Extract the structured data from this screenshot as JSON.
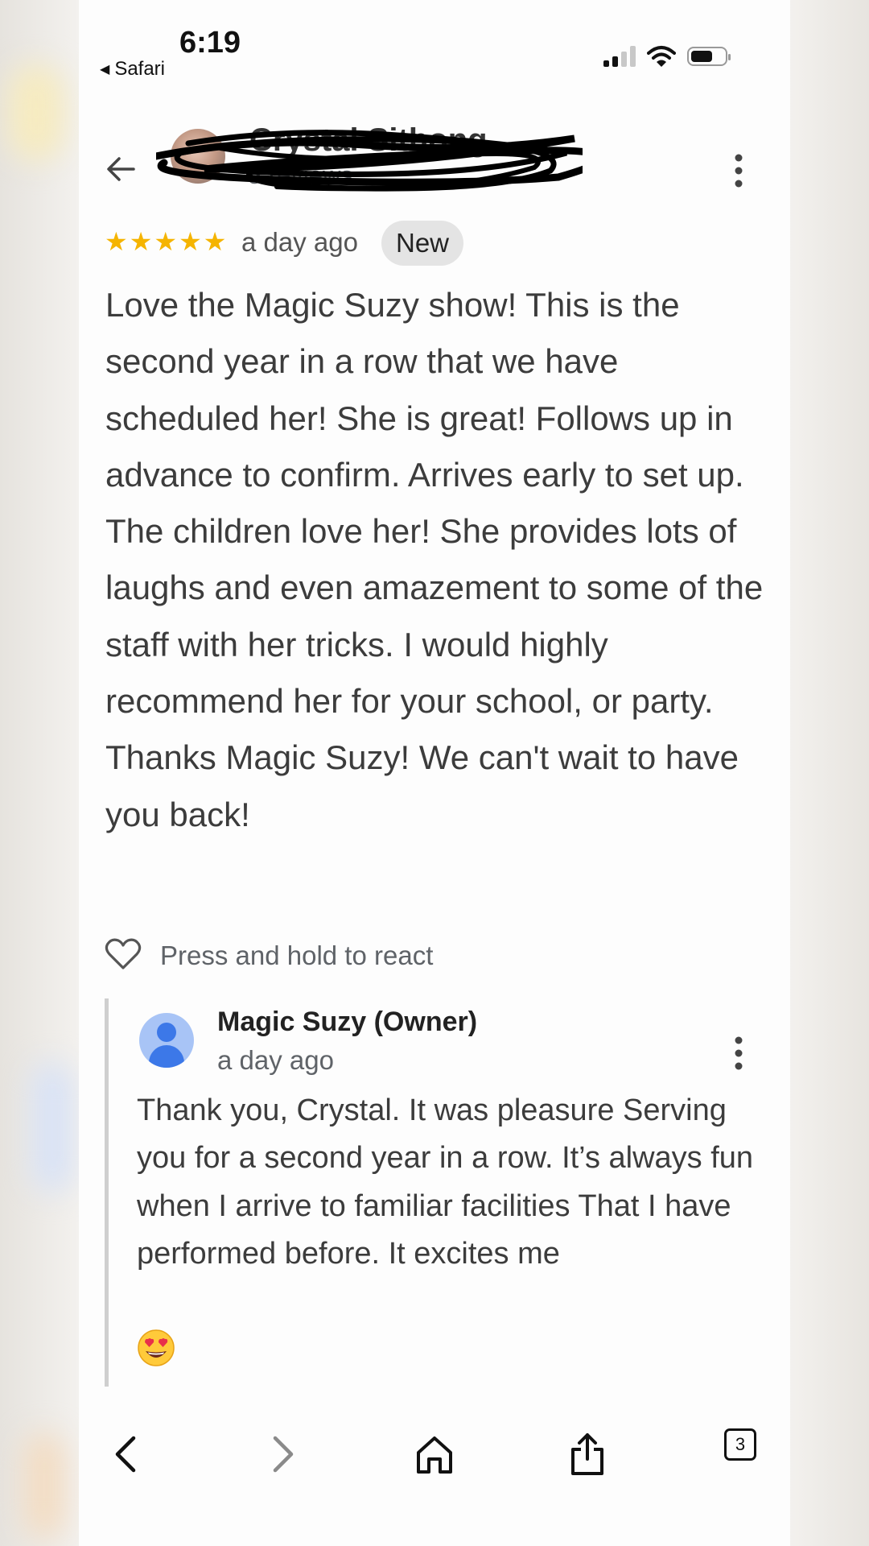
{
  "status_bar": {
    "time": "6:19",
    "back_app": "Safari"
  },
  "header": {
    "user_name": "Crystal Sithong",
    "reviews_count": "5 reviews",
    "name_redacted": true
  },
  "review": {
    "rating": 5,
    "stars": "★★★★★",
    "date": "a day ago",
    "badge": "New",
    "text": "Love the Magic Suzy show! This is the second year in a row that we have scheduled her! She is great! Follows up in advance to confirm. Arrives early to set up. The children love her! She provides lots of laughs and even amazement to some of the staff with her tricks. I would highly recommend her for your school, or party. Thanks Magic Suzy! We can't wait to have you back!"
  },
  "react": {
    "label": "Press and hold to react"
  },
  "owner_reply": {
    "name": "Magic Suzy (Owner)",
    "date": "a day ago",
    "text": "Thank you, Crystal. It was pleasure Serving you for a second year in a row. It’s always fun when I arrive to familiar facilities That I have performed before. It excites me"
  },
  "toolbar": {
    "tabs_count": "3"
  },
  "colors": {
    "star": "#f5b400",
    "badge_bg": "#e4e4e4",
    "owner_avatar": "#3c78e8"
  },
  "icons": [
    "back-arrow-icon",
    "more-vert-icon",
    "heart-icon",
    "chevron-left-icon",
    "chevron-right-icon",
    "home-icon",
    "share-icon",
    "tabs-icon",
    "heart-eyes-emoji"
  ]
}
